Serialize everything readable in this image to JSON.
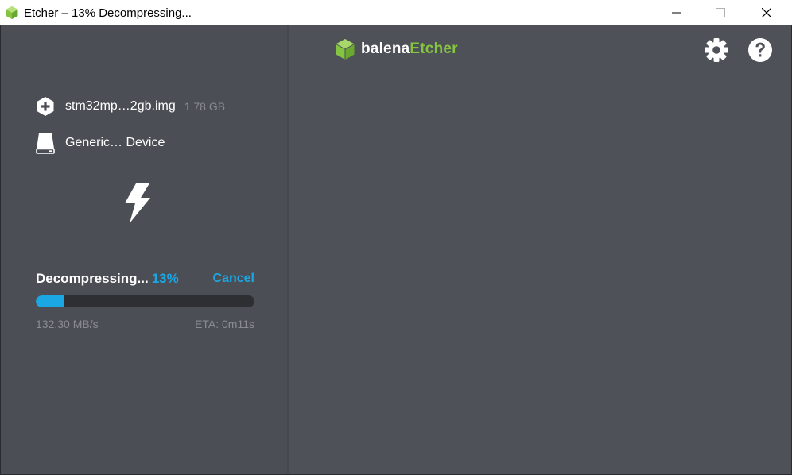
{
  "window": {
    "title": "Etcher – 13% Decompressing..."
  },
  "brand": {
    "name_part1": "balena",
    "name_part2": "Etcher",
    "accent_color": "#85c440"
  },
  "source": {
    "icon": "plus-hexagon-icon",
    "filename": "stm32mp…2gb.img",
    "size": "1.78 GB"
  },
  "target": {
    "icon": "drive-icon",
    "name": "Generic… Device"
  },
  "flash": {
    "icon": "lightning-bolt-icon",
    "status": "Decompressing...",
    "percent_text": "13%",
    "progress_fraction": 0.13,
    "cancel_label": "Cancel",
    "speed": "132.30 MB/s",
    "eta": "ETA: 0m11s",
    "accent_color": "#1aa7e4"
  },
  "toolbar": {
    "settings_icon": "gear-icon",
    "help_icon": "help-icon"
  }
}
